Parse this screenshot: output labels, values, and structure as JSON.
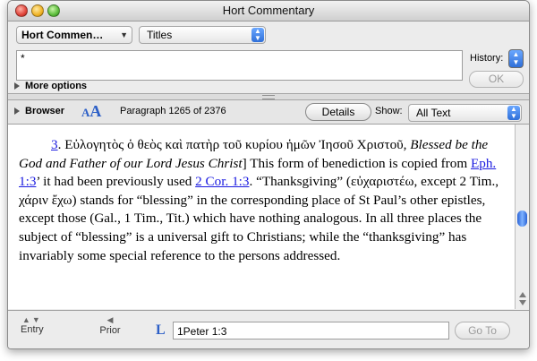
{
  "window": {
    "title": "Hort Commentary"
  },
  "top_panel": {
    "module_select": "Hort Commen…",
    "search_scope_select": "Titles",
    "search_value": "*",
    "history_label": "History:",
    "ok_label": "OK",
    "more_options_label": "More options"
  },
  "browser_bar": {
    "browser_label": "Browser",
    "font_size_icon_small": "A",
    "font_size_icon_large": "A",
    "paragraph_text": "Paragraph 1265  of 2376",
    "details_label": "Details",
    "show_label": "Show:",
    "show_value": "All Text"
  },
  "content": {
    "para_number": "3",
    "greek_heading": "Εὐλογητὸς ὁ θεὸς καὶ πατὴρ τοῦ κυρίου ἡμῶν Ἰησοῦ Χριστοῦ,",
    "italic_translation": "Blessed be the God and Father of our Lord Jesus Christ",
    "text_1": "] This form of benediction is copied from ",
    "link_1": "Eph. 1:3",
    "text_2": "’ it had been previously used ",
    "link_2": "2 Cor. 1:3",
    "text_3": ". “Thanksgiving” (εὐχαριστέω, except 2 Tim., χάριν ἔχω) stands for “blessing” in the corresponding place of St Paul’s other epistles, except those (Gal., 1 Tim., Tit.) which have nothing analogous. In all three places the subject of “blessing” is a universal gift to Christians; while the “thanksgiving” has invariably some special reference to the persons addressed."
  },
  "bottom_bar": {
    "entry_label": "Entry",
    "prior_label": "Prior",
    "link_icon": "L",
    "reference_value": "1Peter  1:3",
    "goto_label": "Go To"
  },
  "colors": {
    "link": "#1a1ae0",
    "accent": "#2c5fc7"
  }
}
